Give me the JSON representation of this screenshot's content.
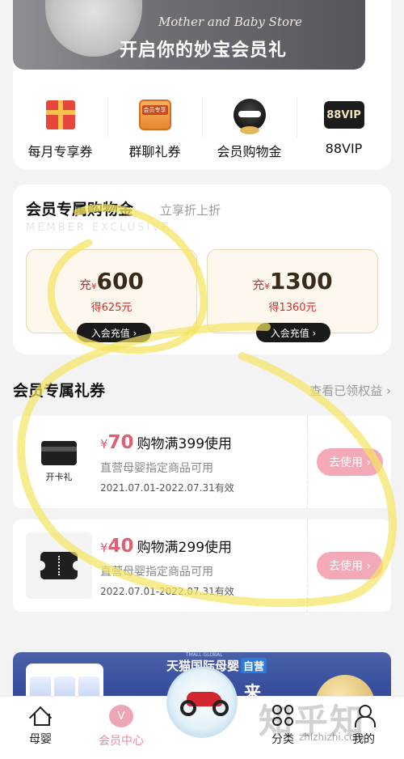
{
  "banner": {
    "store_text": "Mother and Baby Store",
    "title": "开启你的妙宝会员礼"
  },
  "perks": [
    {
      "label": "每月专享券",
      "icon": "gift-box-icon"
    },
    {
      "label": "群聊礼券",
      "icon": "member-bag-icon",
      "badge": "会员专享"
    },
    {
      "label": "会员购物金",
      "icon": "tmall-cat-icon"
    },
    {
      "label": "88VIP",
      "icon": "vip-badge-icon",
      "badge": "88VIP"
    }
  ],
  "gold": {
    "title": "会员专属购物金",
    "subtitle": "立享折上折",
    "english": "MEMBER EXCLUSIVE",
    "options": [
      {
        "prefix": "充",
        "currency": "¥",
        "amount": "600",
        "get": "得625元",
        "button": "入会充值 ›"
      },
      {
        "prefix": "充",
        "currency": "¥",
        "amount": "1300",
        "get": "得1360元",
        "button": "入会充值 ›"
      }
    ]
  },
  "coupons": {
    "title": "会员专属礼券",
    "more": "查看已领权益 ›",
    "items": [
      {
        "thumb_label": "开卡礼",
        "currency": "¥",
        "amount": "70",
        "condition": "购物满399使用",
        "desc": "直营母婴指定商品可用",
        "date": "2021.07.01-2022.07.31有效",
        "button": "去使用 ›"
      },
      {
        "thumb_label": "",
        "currency": "¥",
        "amount": "40",
        "condition": "购物满299使用",
        "desc": "直营母婴指定商品可用",
        "date": "2022.07.01-2022.07.31有效",
        "button": "去使用 ›"
      }
    ]
  },
  "promo": {
    "tiny": "TMALL GLOBAL",
    "title": "天猫国际母婴",
    "tag": "自营",
    "big": "来"
  },
  "nav": {
    "items": [
      {
        "label": "母婴",
        "icon": "home-icon"
      },
      {
        "label": "会员中心",
        "icon": "vip-heart-icon",
        "active": true
      },
      {
        "label": "分类",
        "icon": "category-grid-icon"
      },
      {
        "label": "我的",
        "icon": "profile-icon"
      }
    ],
    "vip_glyph": "V"
  },
  "watermark": {
    "text": "知乎知",
    "url": "zhizhizhi.com"
  },
  "colors": {
    "accent_pink": "#e35e74",
    "button_pink": "#f3a9b8",
    "gold_border": "#ead7b8",
    "highlighter": "#f5e463"
  }
}
